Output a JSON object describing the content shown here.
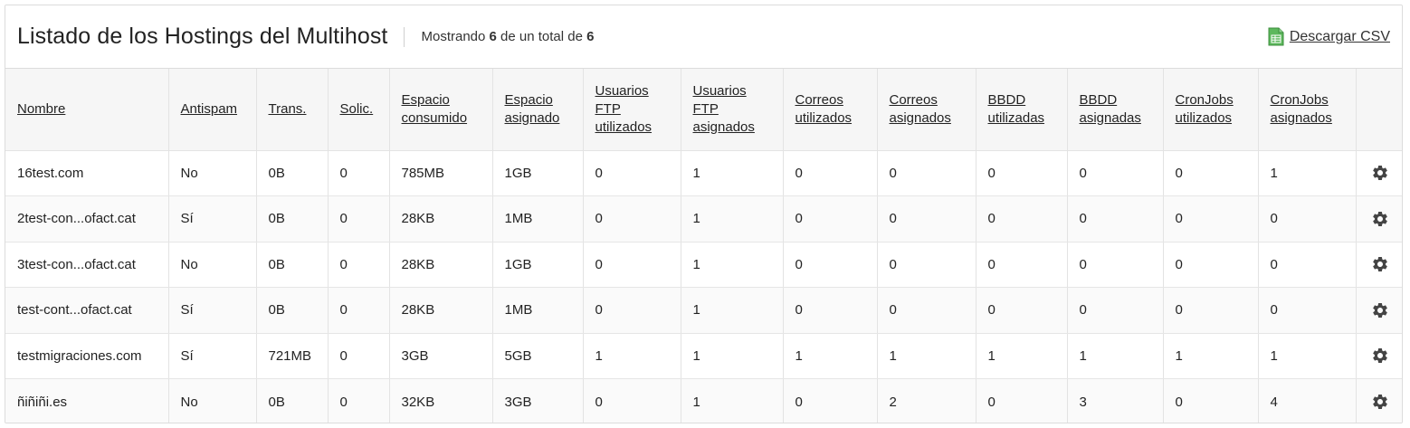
{
  "header": {
    "title": "Listado de los Hostings del Multihost",
    "counter_prefix": "Mostrando",
    "counter_shown": "6",
    "counter_middle": "de un total de",
    "counter_total": "6",
    "csv_label": "Descargar CSV",
    "csv_icon": "spreadsheet-icon"
  },
  "table": {
    "columns": [
      "Nombre",
      "Antispam",
      "Trans.",
      "Solic.",
      "Espacio consumido",
      "Espacio asignado",
      "Usuarios FTP utilizados",
      "Usuarios FTP asignados",
      "Correos utilizados",
      "Correos asignados",
      "BBDD utilizadas",
      "BBDD asignadas",
      "CronJobs utilizados",
      "CronJobs asignados"
    ],
    "rows": [
      [
        "16test.com",
        "No",
        "0B",
        "0",
        "785MB",
        "1GB",
        "0",
        "1",
        "0",
        "0",
        "0",
        "0",
        "0",
        "1"
      ],
      [
        "2test-con...ofact.cat",
        "Sí",
        "0B",
        "0",
        "28KB",
        "1MB",
        "0",
        "1",
        "0",
        "0",
        "0",
        "0",
        "0",
        "0"
      ],
      [
        "3test-con...ofact.cat",
        "No",
        "0B",
        "0",
        "28KB",
        "1GB",
        "0",
        "1",
        "0",
        "0",
        "0",
        "0",
        "0",
        "0"
      ],
      [
        "test-cont...ofact.cat",
        "Sí",
        "0B",
        "0",
        "28KB",
        "1MB",
        "0",
        "1",
        "0",
        "0",
        "0",
        "0",
        "0",
        "0"
      ],
      [
        "testmigraciones.com",
        "Sí",
        "721MB",
        "0",
        "3GB",
        "5GB",
        "1",
        "1",
        "1",
        "1",
        "1",
        "1",
        "1",
        "1"
      ],
      [
        "ñiñiñi.es",
        "No",
        "0B",
        "0",
        "32KB",
        "3GB",
        "0",
        "1",
        "0",
        "2",
        "0",
        "3",
        "0",
        "4"
      ]
    ],
    "row_action_icon": "gear-icon"
  },
  "colors": {
    "border": "#dcdcdc",
    "header_bg": "#f6f6f6",
    "text": "#222222",
    "gear": "#444444",
    "csv_icon_green": "#5cb85c"
  }
}
